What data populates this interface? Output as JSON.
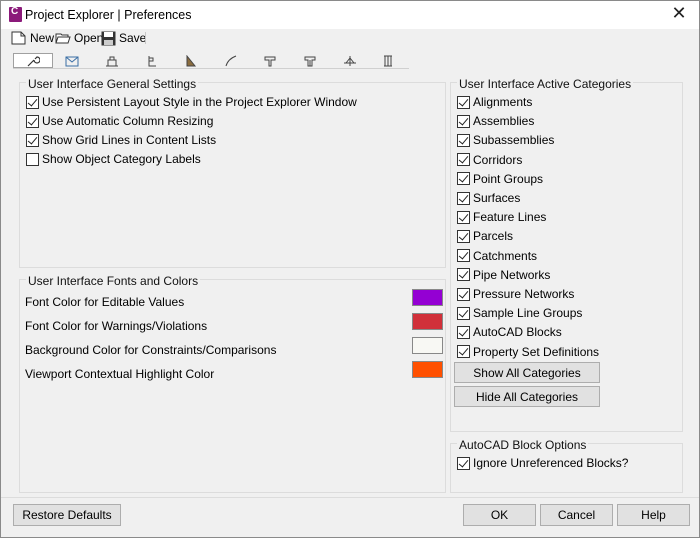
{
  "window": {
    "title": "Project Explorer | Preferences"
  },
  "toolbar": {
    "new_label": "New",
    "open_label": "Open",
    "save_label": "Save"
  },
  "icon_tabs": [
    {
      "icon": "wrench-icon"
    },
    {
      "icon": "envelope-icon"
    },
    {
      "icon": "building-icon"
    },
    {
      "icon": "flag-icon"
    },
    {
      "icon": "surface-icon"
    },
    {
      "icon": "curve-icon"
    },
    {
      "icon": "assembly-icon"
    },
    {
      "icon": "assembly2-icon"
    },
    {
      "icon": "survey-icon"
    },
    {
      "icon": "columns-icon"
    }
  ],
  "general": {
    "title": "User Interface General Settings",
    "options": [
      {
        "label": "Use Persistent Layout Style in the Project Explorer Window",
        "checked": true
      },
      {
        "label": "Use Automatic Column Resizing",
        "checked": true
      },
      {
        "label": "Show Grid Lines in Content Lists",
        "checked": true
      },
      {
        "label": "Show Object Category Labels",
        "checked": false
      }
    ]
  },
  "fonts": {
    "title": "User Interface Fonts and Colors",
    "rows": [
      {
        "label": "Font Color for Editable Values",
        "color": "#9400d3"
      },
      {
        "label": "Font Color for Warnings/Violations",
        "color": "#d1303a"
      },
      {
        "label": "Background Color for Constraints/Comparisons",
        "color": "#f8f8f4"
      },
      {
        "label": "Viewport Contextual Highlight Color",
        "color": "#ff5000"
      }
    ]
  },
  "categories": {
    "title": "User Interface Active Categories",
    "items": [
      {
        "label": "Alignments",
        "checked": true
      },
      {
        "label": "Assemblies",
        "checked": true
      },
      {
        "label": "Subassemblies",
        "checked": true
      },
      {
        "label": "Corridors",
        "checked": true
      },
      {
        "label": "Point Groups",
        "checked": true
      },
      {
        "label": "Surfaces",
        "checked": true
      },
      {
        "label": "Feature Lines",
        "checked": true
      },
      {
        "label": "Parcels",
        "checked": true
      },
      {
        "label": "Catchments",
        "checked": true
      },
      {
        "label": "Pipe Networks",
        "checked": true
      },
      {
        "label": "Pressure Networks",
        "checked": true
      },
      {
        "label": "Sample Line Groups",
        "checked": true
      },
      {
        "label": "AutoCAD Blocks",
        "checked": true
      },
      {
        "label": "Property Set Definitions",
        "checked": true
      }
    ],
    "show_all_label": "Show All Categories",
    "hide_all_label": "Hide All Categories"
  },
  "block_options": {
    "title": "AutoCAD Block Options",
    "ignore_label": "Ignore Unreferenced Blocks?",
    "ignore_checked": true
  },
  "footer": {
    "restore_label": "Restore Defaults",
    "ok_label": "OK",
    "cancel_label": "Cancel",
    "help_label": "Help"
  }
}
